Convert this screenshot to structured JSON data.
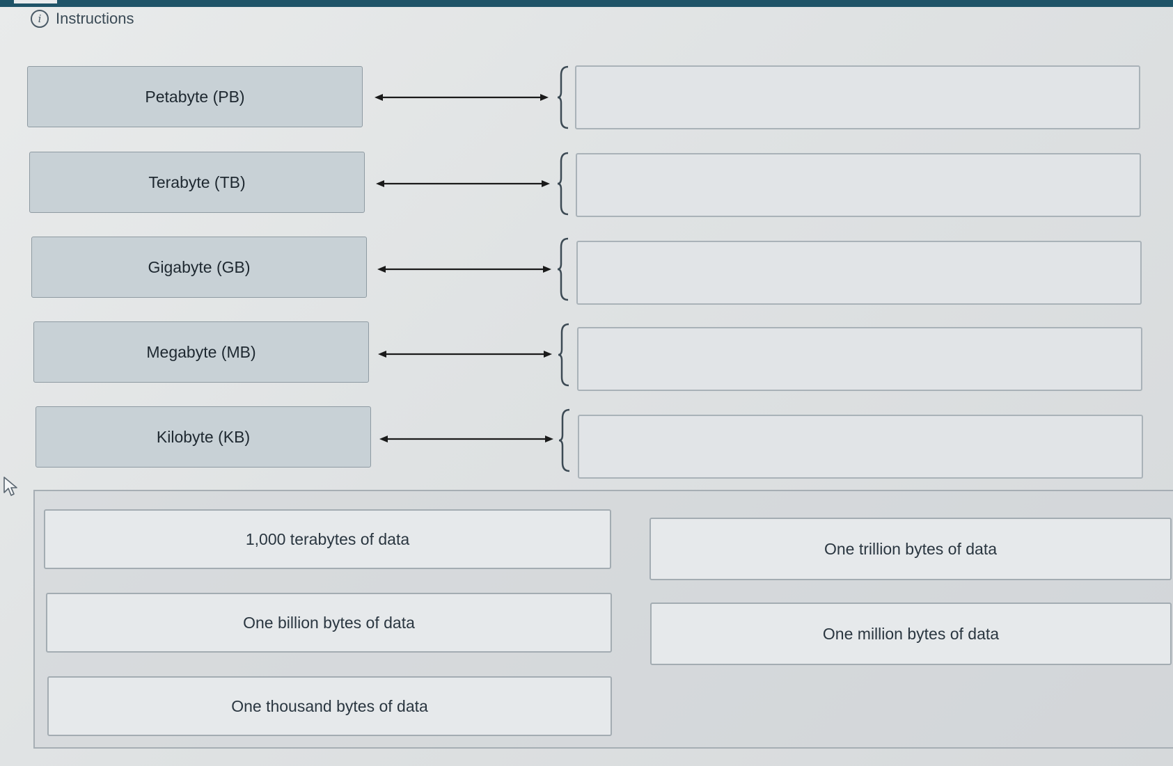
{
  "header": {
    "instructions_label": "Instructions",
    "info_icon_glyph": "i"
  },
  "terms": [
    {
      "label": "Petabyte (PB)"
    },
    {
      "label": "Terabyte (TB)"
    },
    {
      "label": "Gigabyte (GB)"
    },
    {
      "label": "Megabyte (MB)"
    },
    {
      "label": "Kilobyte (KB)"
    }
  ],
  "drop_zones": [
    {
      "value": ""
    },
    {
      "value": ""
    },
    {
      "value": ""
    },
    {
      "value": ""
    },
    {
      "value": ""
    }
  ],
  "options": [
    {
      "label": "1,000 terabytes of data"
    },
    {
      "label": "One trillion bytes of data"
    },
    {
      "label": "One billion bytes of data"
    },
    {
      "label": "One million bytes of data"
    },
    {
      "label": "One thousand bytes of data"
    }
  ],
  "colors": {
    "top_bar": "#1f5468",
    "term_background": "#c8d1d6",
    "drop_zone_background": "#e1e4e7",
    "option_background": "#e6e9eb"
  },
  "icons": {
    "info": "info-circle-icon",
    "arrow": "double-arrow-icon",
    "brace": "left-brace-icon",
    "cursor": "mouse-pointer-icon"
  }
}
